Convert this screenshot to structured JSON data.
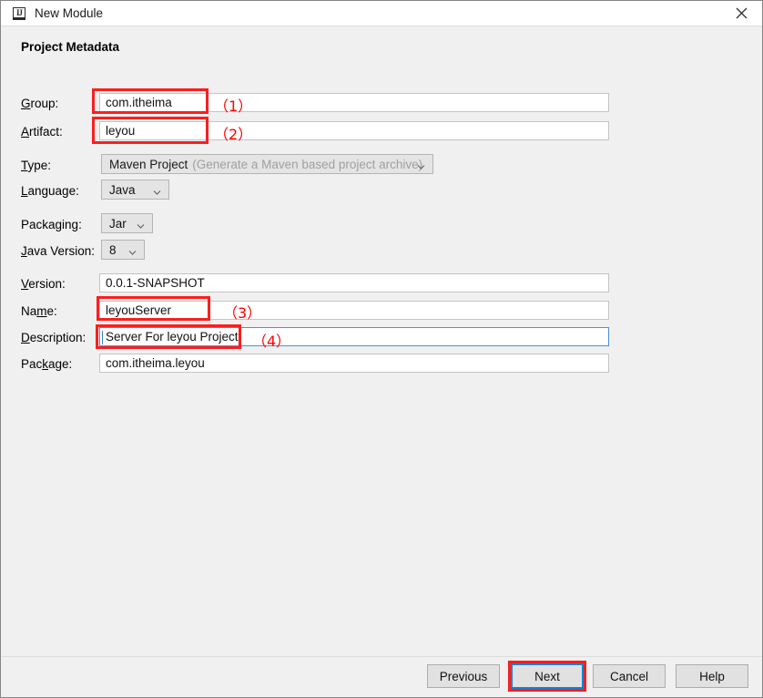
{
  "window": {
    "title": "New Module",
    "app_icon": "intellij-idea-icon",
    "close_icon": "close-icon"
  },
  "form": {
    "section_title": "Project Metadata",
    "fields": [
      {
        "label": "Group:",
        "mnemonic": "G",
        "value": "com.itheima",
        "type": "text"
      },
      {
        "label": "Artifact:",
        "mnemonic": "A",
        "value": "leyou",
        "type": "text"
      },
      {
        "label": "Type:",
        "mnemonic": "T",
        "value": "Maven Project",
        "hint": "(Generate a Maven based project archive)",
        "type": "combo"
      },
      {
        "label": "Language:",
        "mnemonic": "L",
        "value": "Java",
        "type": "combo"
      },
      {
        "label": "Packaging:",
        "mnemonic": "g",
        "value": "Jar",
        "type": "combo"
      },
      {
        "label": "Java Version:",
        "mnemonic": "J",
        "value": "8",
        "type": "combo"
      },
      {
        "label": "Version:",
        "mnemonic": "V",
        "value": "0.0.1-SNAPSHOT",
        "type": "text"
      },
      {
        "label": "Name:",
        "mnemonic": "m",
        "value": "leyouServer",
        "type": "text"
      },
      {
        "label": "Description:",
        "mnemonic": "D",
        "value": "Server For leyou Project",
        "type": "text",
        "focused": true
      },
      {
        "label": "Package:",
        "mnemonic": "k",
        "value": "com.itheima.leyou",
        "type": "text"
      }
    ]
  },
  "annotations": [
    {
      "id": "1",
      "text": "（1）"
    },
    {
      "id": "2",
      "text": "（2）"
    },
    {
      "id": "3",
      "text": "（3）"
    },
    {
      "id": "4",
      "text": "（4）"
    }
  ],
  "footer": {
    "previous_label": "Previous",
    "next_label": "Next",
    "cancel_label": "Cancel",
    "help_label": "Help"
  },
  "colors": {
    "annotation_red": "#fb1e1e",
    "focus_blue": "#0a84d8",
    "window_bg": "#f0f0f0"
  }
}
